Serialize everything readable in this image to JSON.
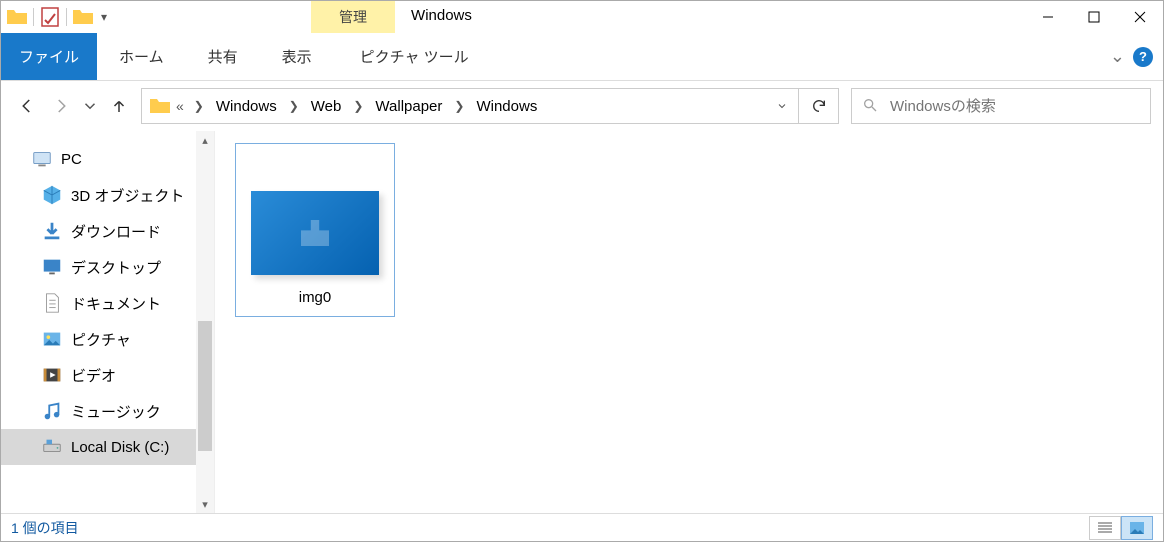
{
  "title": "Windows",
  "contextual_tab_header": "管理",
  "ribbon": {
    "file": "ファイル",
    "home": "ホーム",
    "share": "共有",
    "view": "表示",
    "picture_tools": "ピクチャ ツール"
  },
  "breadcrumb": {
    "prefix": "«",
    "items": [
      "Windows",
      "Web",
      "Wallpaper",
      "Windows"
    ]
  },
  "search_placeholder": "Windowsの検索",
  "tree": {
    "root": "PC",
    "children": [
      "3D オブジェクト",
      "ダウンロード",
      "デスクトップ",
      "ドキュメント",
      "ピクチャ",
      "ビデオ",
      "ミュージック",
      "Local Disk (C:)"
    ],
    "selected_index": 7
  },
  "files": [
    {
      "name": "img0"
    }
  ],
  "status": "1 個の項目"
}
